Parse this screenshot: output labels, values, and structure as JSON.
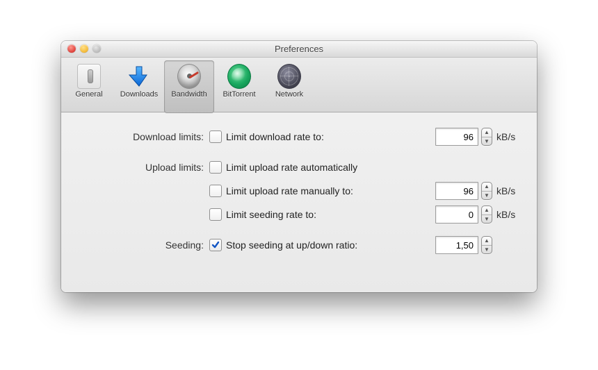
{
  "window": {
    "title": "Preferences"
  },
  "toolbar": {
    "items": [
      {
        "key": "general",
        "label": "General"
      },
      {
        "key": "downloads",
        "label": "Downloads"
      },
      {
        "key": "bandwidth",
        "label": "Bandwidth"
      },
      {
        "key": "bittorrent",
        "label": "BitTorrent"
      },
      {
        "key": "network",
        "label": "Network"
      }
    ],
    "active": "bandwidth"
  },
  "sections": {
    "download_limits_label": "Download limits:",
    "upload_limits_label": "Upload limits:",
    "seeding_label": "Seeding:",
    "unit": "kB/s"
  },
  "options": {
    "limit_download_rate": {
      "label": "Limit download rate to:",
      "checked": false,
      "value": "96"
    },
    "limit_upload_auto": {
      "label": "Limit upload rate automatically",
      "checked": false
    },
    "limit_upload_manual": {
      "label": "Limit upload rate manually to:",
      "checked": false,
      "value": "96"
    },
    "limit_seeding_rate": {
      "label": "Limit seeding rate to:",
      "checked": false,
      "value": "0"
    },
    "stop_seeding_ratio": {
      "label": "Stop seeding at up/down ratio:",
      "checked": true,
      "value": "1,50"
    }
  },
  "icons": {
    "general": "switch-icon",
    "downloads": "download-arrow-icon",
    "bandwidth": "gauge-icon",
    "bittorrent": "wave-icon",
    "network": "globe-icon"
  }
}
